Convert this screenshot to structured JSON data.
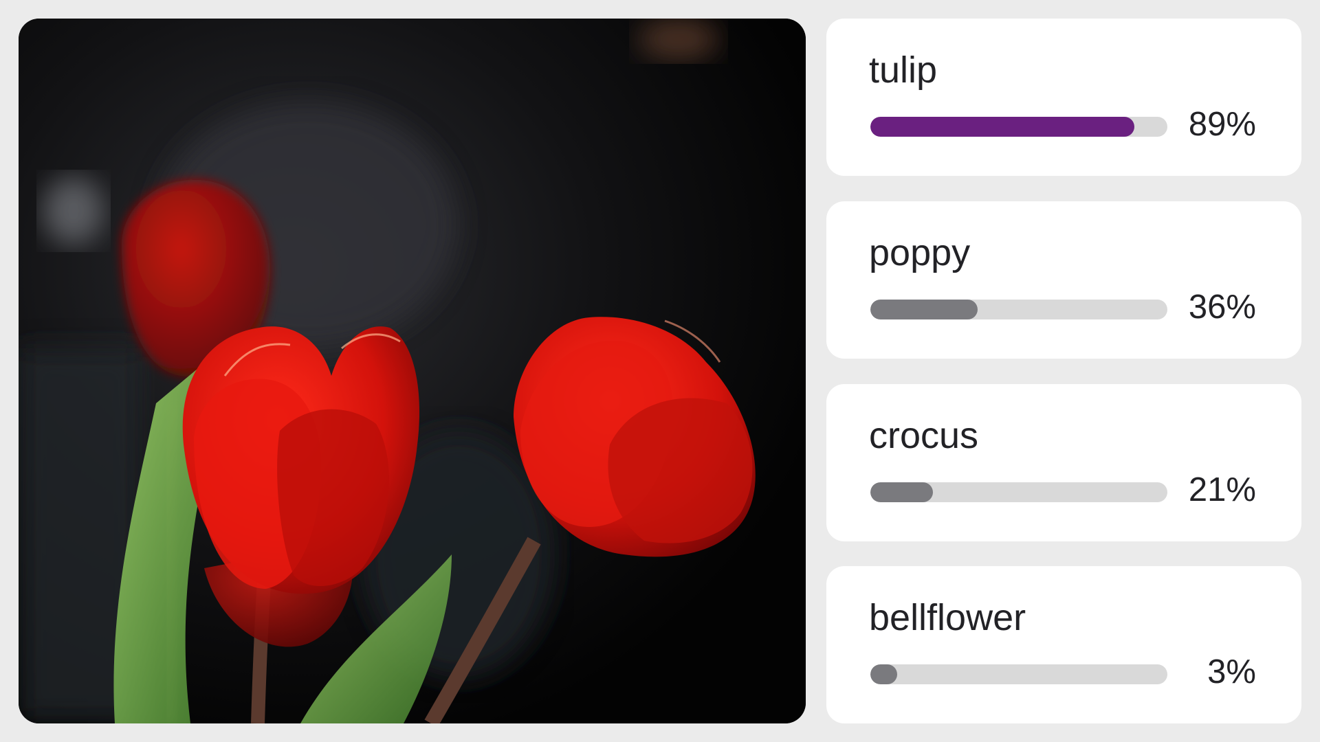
{
  "image": {
    "subject": "red tulip flowers",
    "icon": "photo"
  },
  "colors": {
    "top_bar": "#6a2080",
    "other_bar": "#7a7a7e",
    "track": "#d9d9d9",
    "card": "#ffffff",
    "background": "#ebebeb"
  },
  "predictions": [
    {
      "label": "tulip",
      "percent_text": "89%",
      "value": 0.89
    },
    {
      "label": "poppy",
      "percent_text": "36%",
      "value": 0.36
    },
    {
      "label": "crocus",
      "percent_text": "21%",
      "value": 0.21
    },
    {
      "label": "bellflower",
      "percent_text": "3%",
      "value": 0.03
    }
  ]
}
